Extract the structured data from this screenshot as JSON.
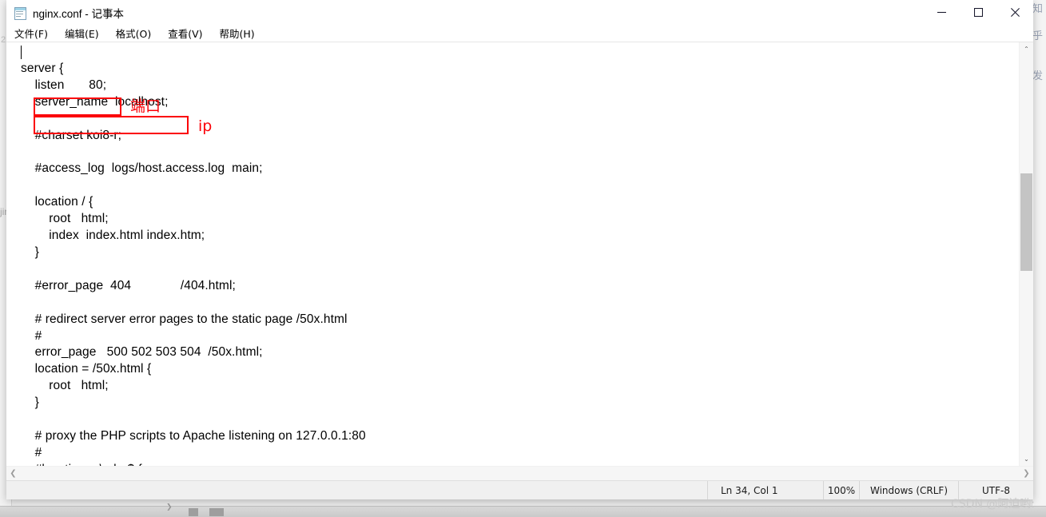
{
  "window": {
    "title": "nginx.conf - 记事本",
    "icon": "notepad-icon",
    "minimize_label": "—",
    "maximize_label": "□",
    "close_label": "✕"
  },
  "menu": {
    "items": [
      {
        "name": "file",
        "text": "文件(F)"
      },
      {
        "name": "edit",
        "text": "编辑(E)"
      },
      {
        "name": "format",
        "text": "格式(O)"
      },
      {
        "name": "view",
        "text": "查看(V)"
      },
      {
        "name": "help",
        "text": "帮助(H)"
      }
    ]
  },
  "editor": {
    "content": "server {\n    listen       80;\n    server_name  localhost;\n\n    #charset koi8-r;\n\n    #access_log  logs/host.access.log  main;\n\n    location / {\n        root   html;\n        index  index.html index.htm;\n    }\n\n    #error_page  404              /404.html;\n\n    # redirect server error pages to the static page /50x.html\n    #\n    error_page   500 502 503 504  /50x.html;\n    location = /50x.html {\n        root   html;\n    }\n\n    # proxy the PHP scripts to Apache listening on 127.0.0.1:80\n    #\n    #location ~ \\.php$ {"
  },
  "annotations": {
    "port_label": "端口",
    "ip_label": "ip",
    "color": "#fb0007"
  },
  "scrollbars": {
    "vertical_up_arrow": "⌃",
    "vertical_down_arrow": "⌄",
    "horizontal_left_arrow": "❮",
    "horizontal_right_arrow": "❯"
  },
  "statusbar": {
    "position": "Ln 34,  Col 1",
    "zoom": "100%",
    "line_ending": "Windows (CRLF)",
    "encoding": "UTF-8"
  },
  "watermark": {
    "text": "CSDN @阿迫哟:"
  },
  "background": {
    "left_line_number": "2",
    "left_fragment": "jin",
    "right_fragment": "知\n乎\n发"
  }
}
